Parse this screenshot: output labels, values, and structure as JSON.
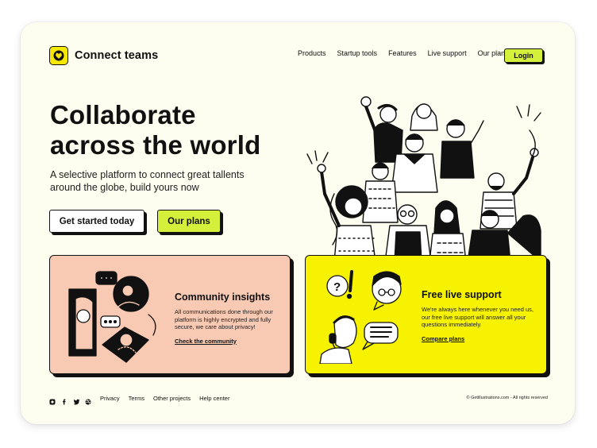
{
  "brand": {
    "name": "Connect teams",
    "logo_icon": "heart-face-icon",
    "accent": "#f6e800"
  },
  "nav": {
    "items": [
      "Products",
      "Startup tools",
      "Features",
      "Live support",
      "Our plans"
    ],
    "login": "Login"
  },
  "hero": {
    "title_line1": "Collaborate",
    "title_line2": "across the world",
    "subtitle": "A selective platform to connect great tallents around the globe, build yours now",
    "cta_primary": "Get started today",
    "cta_secondary": "Our plans"
  },
  "features": [
    {
      "title": "Community insights",
      "description": "All communications done through our platform is highly encrypted and fully secure, we care about privacy!",
      "link": "Check the community",
      "background": "#f8c9b3"
    },
    {
      "title": "Free live support",
      "description": "We're always here whenever you need us, our free live support will answer all your questions immediately.",
      "link": "Compare plans",
      "background": "#f6f200"
    }
  ],
  "footer": {
    "socials": [
      "instagram-icon",
      "facebook-icon",
      "twitter-icon",
      "dribbble-icon"
    ],
    "links": [
      "Privacy",
      "Terms",
      "Other projects",
      "Help center"
    ],
    "copyright": "© Getillustrations.com - All rights reserved"
  },
  "colors": {
    "lime": "#d4f03b",
    "cream": "#fdfdf0",
    "peach": "#f8c9b3",
    "yellow": "#f6f200"
  }
}
